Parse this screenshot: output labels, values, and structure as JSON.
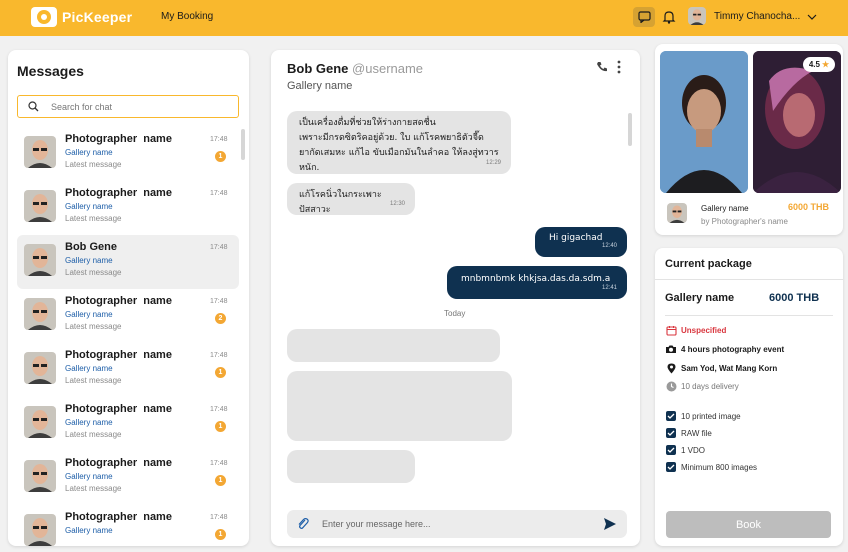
{
  "header": {
    "brand": "PicKeeper",
    "nav_booking": "My Booking",
    "user_name": "Timmy Chanocha...",
    "brand_color": "#f9b82d"
  },
  "messages_panel": {
    "title": "Messages",
    "search_placeholder": "Search for chat",
    "conversations": [
      {
        "name": "Photographer  name",
        "gallery": "Gallery name",
        "last": "Latest message",
        "time": "17:48",
        "badge": "1"
      },
      {
        "name": "Photographer  name",
        "gallery": "Gallery name",
        "last": "Latest message",
        "time": "17:48",
        "badge": ""
      },
      {
        "name": "Bob Gene",
        "gallery": "Gallery name",
        "last": "Latest message",
        "time": "17:48",
        "badge": ""
      },
      {
        "name": "Photographer  name",
        "gallery": "Gallery name",
        "last": "Latest message",
        "time": "17:48",
        "badge": "2"
      },
      {
        "name": "Photographer  name",
        "gallery": "Gallery name",
        "last": "Latest message",
        "time": "17:48",
        "badge": "1"
      },
      {
        "name": "Photographer  name",
        "gallery": "Gallery name",
        "last": "Latest message",
        "time": "17:48",
        "badge": "1"
      },
      {
        "name": "Photographer  name",
        "gallery": "Gallery name",
        "last": "Latest message",
        "time": "17:48",
        "badge": "1"
      },
      {
        "name": "Photographer  name",
        "gallery": "Gallery name",
        "last": "",
        "time": "17:48",
        "badge": "1"
      }
    ]
  },
  "chat": {
    "name": "Bob Gene",
    "username": "@username",
    "gallery": "Gallery name",
    "messages": [
      {
        "dir": "in",
        "lines": [
          "เป็นเครื่องดื่มที่ช่วยให้ร่างกายสดชื่น",
          "เพราะมีกรดซิตริคอยู่ด้วย. ใบ แก้โรคพยาธิตัวจี๊ด",
          "ยากัดเสมหะ แก้ไอ ขับเมือกมันในลำคอ ให้ลงสู่ทวารหนัก."
        ],
        "time": "12:29"
      },
      {
        "dir": "in",
        "lines": [
          "แก้โรคนิ่วในกระเพาะปัสสาวะ"
        ],
        "time": "12:30"
      },
      {
        "dir": "out",
        "lines": [
          "Hi gigachad"
        ],
        "time": "12:40"
      },
      {
        "dir": "out",
        "lines": [
          "mnbmnbmk khkjsa.das.da.sdm.a"
        ],
        "time": "12:41"
      }
    ],
    "divider": "Today",
    "composer_placeholder": "Enter your message here..."
  },
  "gallery_card": {
    "rating": "4.5",
    "gallery": "Gallery name",
    "by": "by Photographer's name",
    "price": "6000 THB"
  },
  "package": {
    "title": "Current package",
    "gallery": "Gallery name",
    "price": "6000 THB",
    "date": "Unspecified",
    "event": "4 hours photography event",
    "location": "Sam Yod, Wat Mang Korn",
    "delivery": "10 days delivery",
    "items": [
      "10 printed image",
      "RAW file",
      "1 VDO",
      "Minimum 800 images"
    ],
    "book_label": "Book"
  }
}
